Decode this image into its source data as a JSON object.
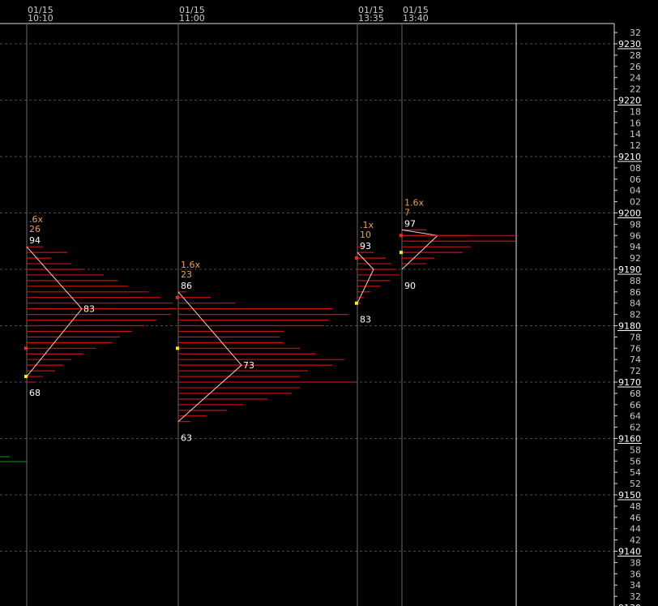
{
  "colors": {
    "background": "#000000",
    "grid": "#4a4a4a",
    "bar": "#cc1111",
    "profile_line": "#ffd0b8",
    "stat_text": "#f0a040",
    "open_marker": "#ff2020",
    "close_marker": "#ffee00",
    "misc_line": "#1c8f1c"
  },
  "axis": {
    "y_min": 9130,
    "y_max": 9236,
    "step": 2,
    "major_every": 10,
    "major_labels": [
      "9230",
      "9220",
      "9210",
      "9200",
      "9190",
      "9180",
      "9170",
      "9160",
      "9150",
      "9140"
    ],
    "minor_label_format": "last two digits"
  },
  "periods": [
    {
      "date": "01/15",
      "time": "10:10",
      "ratio": ".6x",
      "count": "26",
      "high": 9194,
      "low": 9171,
      "poc": 9183,
      "high_label": "94",
      "low_label": "68",
      "poc_label": "83",
      "open": 9176,
      "close": 9171,
      "bars": [
        {
          "price": 9194,
          "len": 20
        },
        {
          "price": 9193,
          "len": 50
        },
        {
          "price": 9192,
          "len": 30
        },
        {
          "price": 9191,
          "len": 55
        },
        {
          "price": 9190,
          "len": 70
        },
        {
          "price": 9189,
          "len": 95
        },
        {
          "price": 9188,
          "len": 112
        },
        {
          "price": 9187,
          "len": 125
        },
        {
          "price": 9186,
          "len": 150
        },
        {
          "price": 9185,
          "len": 165
        },
        {
          "price": 9184,
          "len": 180
        },
        {
          "price": 9183,
          "len": 185
        },
        {
          "price": 9182,
          "len": 178
        },
        {
          "price": 9181,
          "len": 160
        },
        {
          "price": 9180,
          "len": 145
        },
        {
          "price": 9179,
          "len": 130
        },
        {
          "price": 9178,
          "len": 115
        },
        {
          "price": 9177,
          "len": 105
        },
        {
          "price": 9176,
          "len": 85
        },
        {
          "price": 9175,
          "len": 70
        },
        {
          "price": 9174,
          "len": 55
        },
        {
          "price": 9173,
          "len": 45
        },
        {
          "price": 9172,
          "len": 35
        },
        {
          "price": 9171,
          "len": 20
        },
        {
          "price": 9170,
          "len": 10
        }
      ]
    },
    {
      "date": "01/15",
      "time": "11:00",
      "ratio": "1.6x",
      "count": "23",
      "high": 9186,
      "low": 9163,
      "poc": 9173,
      "high_label": "86",
      "low_label": "63",
      "poc_label": "73",
      "open": 9185,
      "close": 9176,
      "bars": [
        {
          "price": 9186,
          "len": 10
        },
        {
          "price": 9185,
          "len": 40
        },
        {
          "price": 9184,
          "len": 70
        },
        {
          "price": 9183,
          "len": 190
        },
        {
          "price": 9182,
          "len": 210
        },
        {
          "price": 9181,
          "len": 185
        },
        {
          "price": 9180,
          "len": 180
        },
        {
          "price": 9179,
          "len": 130
        },
        {
          "price": 9178,
          "len": 125
        },
        {
          "price": 9177,
          "len": 130
        },
        {
          "price": 9176,
          "len": 150
        },
        {
          "price": 9175,
          "len": 170
        },
        {
          "price": 9174,
          "len": 205
        },
        {
          "price": 9173,
          "len": 190
        },
        {
          "price": 9172,
          "len": 160
        },
        {
          "price": 9171,
          "len": 150
        },
        {
          "price": 9170,
          "len": 220
        },
        {
          "price": 9169,
          "len": 150
        },
        {
          "price": 9168,
          "len": 140
        },
        {
          "price": 9167,
          "len": 110
        },
        {
          "price": 9166,
          "len": 80
        },
        {
          "price": 9165,
          "len": 60
        },
        {
          "price": 9164,
          "len": 35
        },
        {
          "price": 9163,
          "len": 15
        }
      ]
    },
    {
      "date": "01/15",
      "time": "13:35",
      "ratio": ".1x",
      "count": "10",
      "high": 9193,
      "low": 9184,
      "poc": 9190,
      "high_label": "93",
      "low_label": "83",
      "poc_label": "",
      "open": 9192,
      "close": 9184,
      "bars": [
        {
          "price": 9194,
          "len": 8
        },
        {
          "price": 9193,
          "len": 20
        },
        {
          "price": 9192,
          "len": 35
        },
        {
          "price": 9191,
          "len": 42
        },
        {
          "price": 9190,
          "len": 48
        },
        {
          "price": 9189,
          "len": 52
        },
        {
          "price": 9188,
          "len": 40
        },
        {
          "price": 9187,
          "len": 28
        },
        {
          "price": 9186,
          "len": 16
        },
        {
          "price": 9185,
          "len": 8
        },
        {
          "price": 9184,
          "len": 4
        }
      ]
    },
    {
      "date": "01/15",
      "time": "13:40",
      "ratio": "1.6x",
      "count": "7",
      "high": 9197,
      "low": 9190,
      "poc": 9196,
      "high_label": "97",
      "low_label": "90",
      "poc_label": "",
      "open": 9196,
      "close": 9193,
      "bars": [
        {
          "price": 9197,
          "len": 30
        },
        {
          "price": 9196,
          "len": 85
        },
        {
          "price": 9195,
          "len": 140
        },
        {
          "price": 9194,
          "len": 85
        },
        {
          "price": 9193,
          "len": 75
        },
        {
          "price": 9192,
          "len": 40
        },
        {
          "price": 9191,
          "len": 30
        }
      ]
    }
  ]
}
